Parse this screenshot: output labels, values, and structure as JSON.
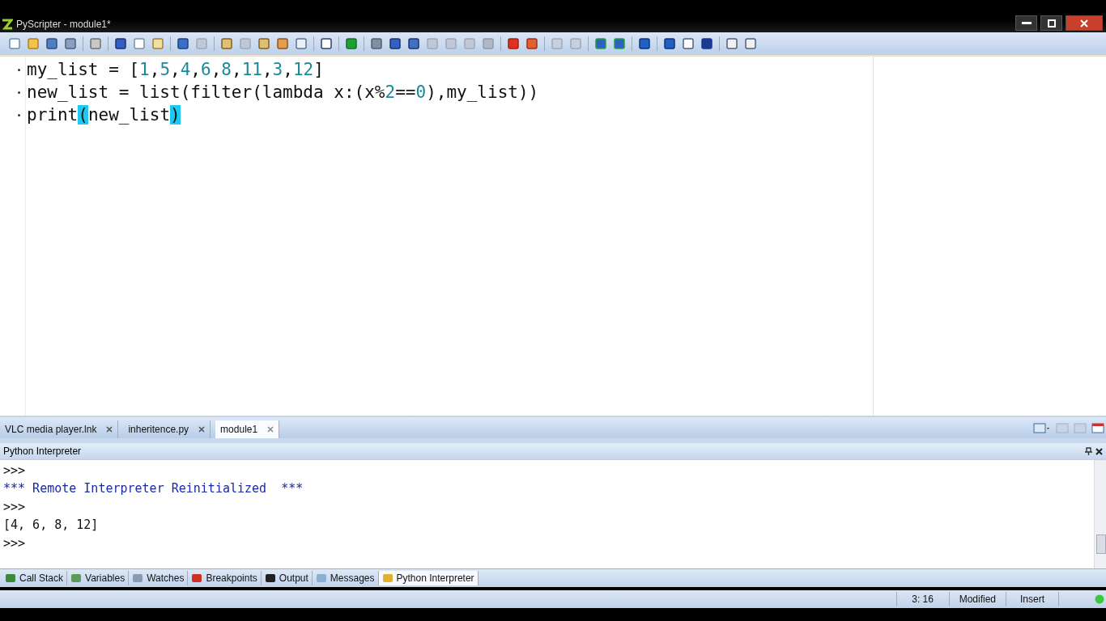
{
  "window": {
    "title": "PyScripter - module1*"
  },
  "editor": {
    "lines": [
      [
        {
          "kind": "text",
          "text": "my_list = ["
        },
        {
          "kind": "number",
          "text": "1"
        },
        {
          "kind": "text",
          "text": ","
        },
        {
          "kind": "number",
          "text": "5"
        },
        {
          "kind": "text",
          "text": ","
        },
        {
          "kind": "number",
          "text": "4"
        },
        {
          "kind": "text",
          "text": ","
        },
        {
          "kind": "number",
          "text": "6"
        },
        {
          "kind": "text",
          "text": ","
        },
        {
          "kind": "number",
          "text": "8"
        },
        {
          "kind": "text",
          "text": ","
        },
        {
          "kind": "number",
          "text": "11"
        },
        {
          "kind": "text",
          "text": ","
        },
        {
          "kind": "number",
          "text": "3"
        },
        {
          "kind": "text",
          "text": ","
        },
        {
          "kind": "number",
          "text": "12"
        },
        {
          "kind": "text",
          "text": "]"
        }
      ],
      [
        {
          "kind": "text",
          "text": "new_list = list(filter(lambda x:(x%"
        },
        {
          "kind": "number",
          "text": "2"
        },
        {
          "kind": "text",
          "text": "=="
        },
        {
          "kind": "number",
          "text": "0"
        },
        {
          "kind": "text",
          "text": "),my_list))"
        }
      ],
      [
        {
          "kind": "text",
          "text": "print"
        },
        {
          "kind": "match",
          "text": "("
        },
        {
          "kind": "text",
          "text": "new_list"
        },
        {
          "kind": "match",
          "text": ")"
        }
      ]
    ]
  },
  "file_tabs": [
    {
      "label": "VLC media player.lnk",
      "selected": false
    },
    {
      "label": "inheritence.py",
      "selected": false
    },
    {
      "label": "module1",
      "selected": true
    }
  ],
  "interpreter": {
    "title": "Python Interpreter",
    "lines": [
      {
        "kind": "prompt",
        "text": ">>>"
      },
      {
        "kind": "message",
        "text": "*** Remote Interpreter Reinitialized  ***"
      },
      {
        "kind": "prompt",
        "text": ">>>"
      },
      {
        "kind": "output",
        "text": "[4, 6, 8, 12]"
      },
      {
        "kind": "prompt",
        "text": ">>>"
      }
    ]
  },
  "bottom_tabs": [
    {
      "label": "Call Stack",
      "selected": false
    },
    {
      "label": "Variables",
      "selected": false
    },
    {
      "label": "Watches",
      "selected": false
    },
    {
      "label": "Breakpoints",
      "selected": false
    },
    {
      "label": "Output",
      "selected": false
    },
    {
      "label": "Messages",
      "selected": false
    },
    {
      "label": "Python Interpreter",
      "selected": true
    }
  ],
  "status_bar": {
    "position": "3: 16",
    "state": "Modified",
    "mode": "Insert"
  }
}
